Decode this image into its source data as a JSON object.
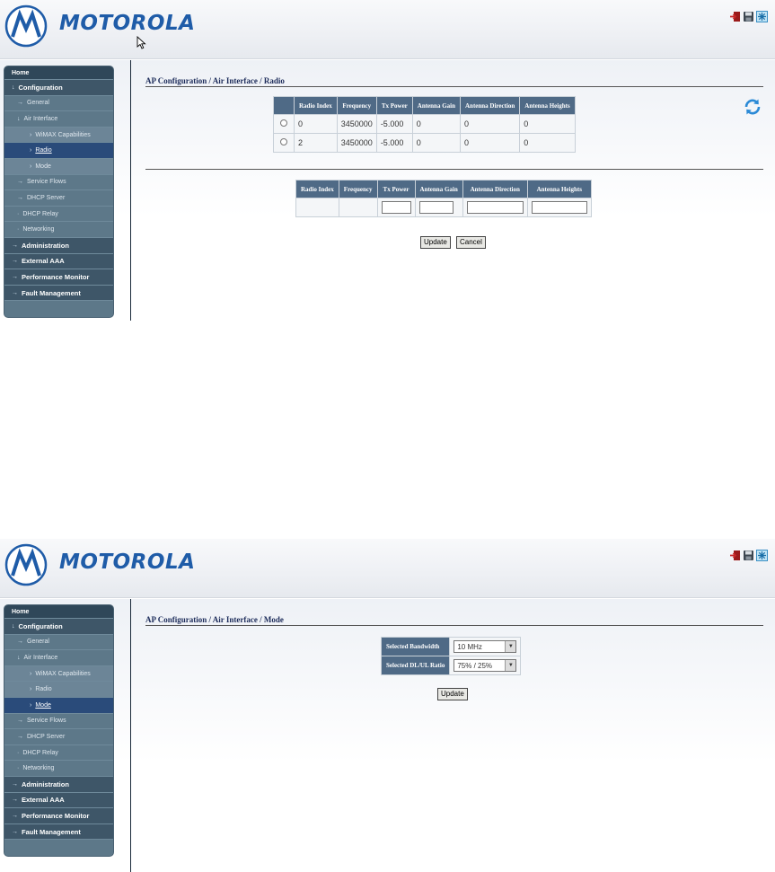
{
  "brand": "MOTOROLA",
  "colors": {
    "accent": "#1f5ca8",
    "nav_bg": "#5d7889",
    "nav_active": "#2a4b7a",
    "table_header": "#4f6a86"
  },
  "toolbar": {
    "icons": [
      "logout-icon",
      "save-icon",
      "snowflake-icon"
    ]
  },
  "sidebar": {
    "home": "Home",
    "configuration": "Configuration",
    "general": "General",
    "air_interface": "Air Interface",
    "wimax_capabilities": "WiMAX Capabilities",
    "radio": "Radio",
    "mode": "Mode",
    "service_flows": "Service Flows",
    "dhcp_server": "DHCP Server",
    "dhcp_relay": "DHCP Relay",
    "networking": "Networking",
    "administration": "Administration",
    "external_aaa": "External AAA",
    "performance_monitor": "Performance Monitor",
    "fault_management": "Fault Management"
  },
  "radio_page": {
    "title": "AP Configuration / Air Interface / Radio",
    "columns": [
      "Radio Index",
      "Frequency",
      "Tx Power",
      "Antenna Gain",
      "Antenna Direction",
      "Antenna Heights"
    ],
    "rows": [
      {
        "radio_index": "0",
        "frequency": "3450000",
        "tx_power": "-5.000",
        "antenna_gain": "0",
        "antenna_direction": "0",
        "antenna_heights": "0"
      },
      {
        "radio_index": "2",
        "frequency": "3450000",
        "tx_power": "-5.000",
        "antenna_gain": "0",
        "antenna_direction": "0",
        "antenna_heights": "0"
      }
    ],
    "edit_columns": [
      "Radio Index",
      "Frequency",
      "Tx Power",
      "Antenna Gain",
      "Antenna Direction",
      "Antenna Heights"
    ],
    "update_label": "Update",
    "cancel_label": "Cancel"
  },
  "mode_page": {
    "title": "AP Configuration / Air Interface / Mode",
    "bandwidth_label": "Selected Bandwidth",
    "bandwidth_value": "10 MHz",
    "ratio_label": "Selected DL/UL Ratio",
    "ratio_value": "75% / 25%",
    "update_label": "Update"
  }
}
